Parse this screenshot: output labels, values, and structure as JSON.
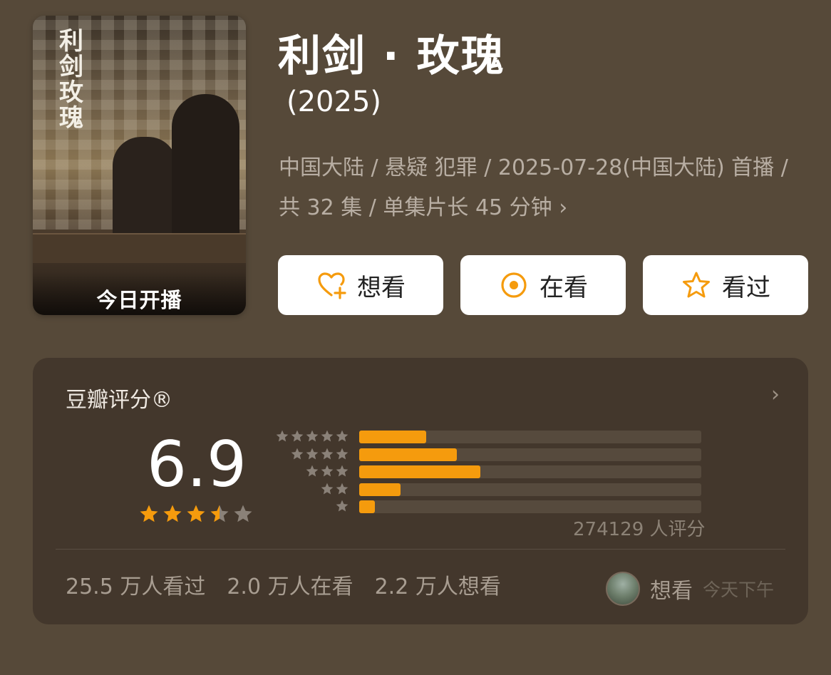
{
  "poster": {
    "title_vertical": "利剑玫瑰",
    "badge": "今日开播"
  },
  "header": {
    "title": "利剑 · 玫瑰",
    "year": "(2025)",
    "meta": "中国大陆 / 悬疑 犯罪 / 2025-07-28(中国大陆) 首播 / 共 32 集 / 单集片长 45 分钟",
    "meta_chevron": "›"
  },
  "actions": [
    {
      "label": "想看",
      "icon": "heart-plus-icon"
    },
    {
      "label": "在看",
      "icon": "target-icon"
    },
    {
      "label": "看过",
      "icon": "star-outline-icon"
    }
  ],
  "rating": {
    "title": "豆瓣评分®",
    "chevron": "›",
    "score": "6.9",
    "stars_value": 3.5,
    "count_text": "274129 人评分",
    "distribution": [
      {
        "stars": 5,
        "fraction": 0.195
      },
      {
        "stars": 4,
        "fraction": 0.285
      },
      {
        "stars": 3,
        "fraction": 0.355
      },
      {
        "stars": 2,
        "fraction": 0.12
      },
      {
        "stars": 1,
        "fraction": 0.045
      }
    ]
  },
  "stats": {
    "watched": "25.5 万人看过",
    "watching": "2.0 万人在看",
    "want": "2.2 万人想看"
  },
  "user_status": {
    "label": "想看",
    "time": "今天下午"
  },
  "colors": {
    "background": "#564939",
    "card": "#43372c",
    "accent": "#f59b0d",
    "star_off": "#8a8178"
  }
}
